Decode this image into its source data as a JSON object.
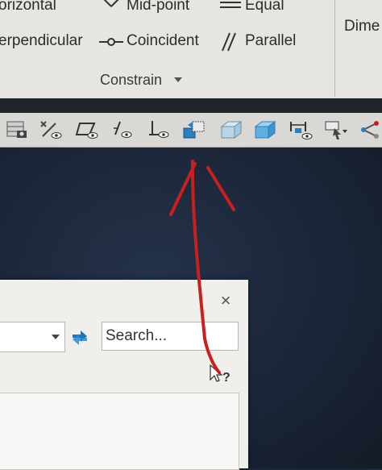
{
  "ribbon": {
    "row1": {
      "horizontal": "orizontal",
      "midpoint": "Mid-point",
      "equal": "Equal",
      "dimension": "Dime"
    },
    "row2": {
      "perpendicular": "erpendicular",
      "coincident": "Coincident",
      "parallel": "Parallel"
    },
    "panel_title": "Constrain"
  },
  "toolbar": {
    "buttons": [
      "snapshot-icon",
      "constraint-display-icon",
      "hide-shape-icon",
      "show-constraint-icon",
      "show-dimension-icon",
      "convert-body-icon",
      "box-solid-icon",
      "box-transparent-icon",
      "measure-icon",
      "tool-dropdown-icon",
      "more-icon"
    ]
  },
  "dialog": {
    "close_glyph": "×",
    "search_placeholder": "Search...",
    "help_glyph": "?"
  },
  "colors": {
    "ribbon_bg": "#e6e5e2",
    "toolbar_bg": "#d9d8d5",
    "viewport_bg": "#1b2638",
    "dialog_bg": "#f0efec",
    "accent_blue": "#2a7fbf",
    "annotation_red": "#c8201e"
  }
}
